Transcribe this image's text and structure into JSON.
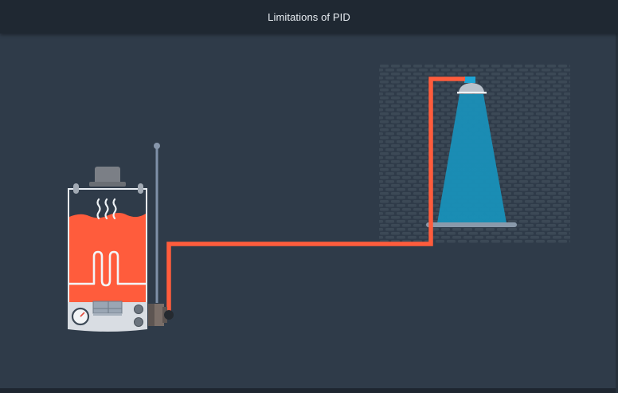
{
  "header": {
    "title": "Limitations of PID"
  },
  "colors": {
    "background": "#2f3b49",
    "header": "#1f2832",
    "hot_water": "#ff5c3c",
    "shower_spray": "#1b97c0",
    "brick": "#3c4956",
    "boiler_body": "#d9dde3"
  },
  "icons": {
    "heater": "water-heater-icon",
    "shower": "shower-head-icon",
    "gauge": "temperature-gauge-icon",
    "steam": "steam-icon"
  }
}
